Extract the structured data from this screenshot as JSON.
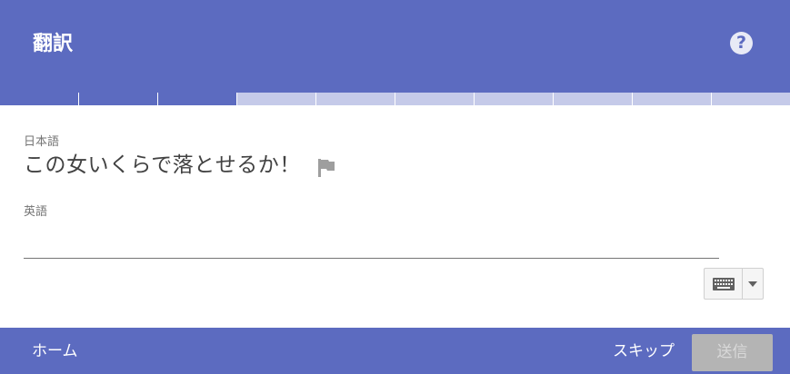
{
  "header": {
    "title": "翻訳",
    "help_icon": "?"
  },
  "progress": {
    "completed": 3,
    "total": 10
  },
  "source": {
    "language": "日本語",
    "sentence": "この女いくらで落とせるか！",
    "flag_icon": "flag-icon"
  },
  "target": {
    "language": "英語",
    "value": "",
    "keyboard_icon": "keyboard-icon",
    "dropdown_icon": "caret-down-icon"
  },
  "footer": {
    "home_label": "ホーム",
    "skip_label": "スキップ",
    "send_label": "送信"
  },
  "colors": {
    "primary": "#5c6bc0",
    "progress_remaining": "#c5cae9",
    "send_disabled": "#b4b4b4"
  }
}
